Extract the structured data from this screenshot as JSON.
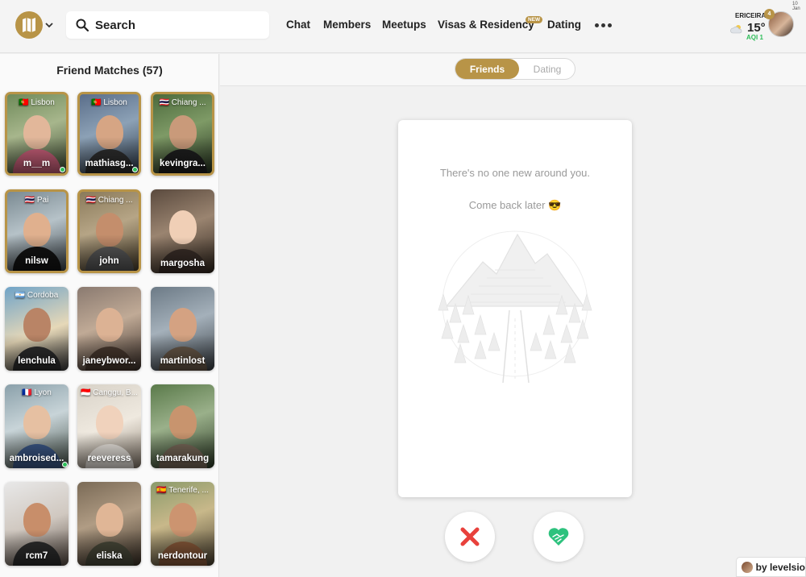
{
  "header": {
    "search_placeholder": "Search",
    "nav": [
      {
        "label": "Chat"
      },
      {
        "label": "Members"
      },
      {
        "label": "Meetups"
      },
      {
        "label": "Visas & Residency"
      },
      {
        "label": "Dating"
      }
    ],
    "new_badge": "NEW",
    "weather": {
      "city": "ERICEIRA",
      "temp": "15°",
      "aqi": "AQI 1"
    },
    "notification_count": "4",
    "date_corner": "10 Jan"
  },
  "sidebar": {
    "title": "Friend Matches (57)",
    "matches": [
      {
        "name": "m__m",
        "location": "🇵🇹 Lisbon",
        "highlight": true,
        "online": true
      },
      {
        "name": "mathiasg...",
        "location": "🇵🇹 Lisbon",
        "highlight": true,
        "online": true
      },
      {
        "name": "kevingra...",
        "location": "🇹🇭 Chiang ...",
        "highlight": true,
        "online": false
      },
      {
        "name": "nilsw",
        "location": "🇹🇭 Pai",
        "highlight": true,
        "online": false
      },
      {
        "name": "john",
        "location": "🇹🇭 Chiang ...",
        "highlight": true,
        "online": false
      },
      {
        "name": "margosha",
        "location": "",
        "highlight": false,
        "online": false
      },
      {
        "name": "lenchula",
        "location": "🇦🇷 Cordoba",
        "highlight": false,
        "online": false
      },
      {
        "name": "janeybwor...",
        "location": "",
        "highlight": false,
        "online": false
      },
      {
        "name": "martinlost",
        "location": "",
        "highlight": false,
        "online": false
      },
      {
        "name": "ambroised...",
        "location": "🇫🇷 Lyon",
        "highlight": false,
        "online": true
      },
      {
        "name": "reeveress",
        "location": "🇮🇩 Canggu, B...",
        "highlight": false,
        "online": false
      },
      {
        "name": "tamarakung",
        "location": "",
        "highlight": false,
        "online": false
      },
      {
        "name": "rcm7",
        "location": "",
        "highlight": false,
        "online": false
      },
      {
        "name": "eliska",
        "location": "",
        "highlight": false,
        "online": false
      },
      {
        "name": "nerdontour",
        "location": "🇪🇸 Tenerife, ...",
        "highlight": false,
        "online": false
      }
    ]
  },
  "main": {
    "tabs": {
      "friends": "Friends",
      "dating": "Dating",
      "active": "Friends"
    },
    "empty_line1": "There's no one new around you.",
    "empty_line2": "Come back later 😎",
    "actions": {
      "reject_icon": "x-icon",
      "accept_icon": "handshake-heart-icon"
    }
  },
  "byline": "by levelsio",
  "colors": {
    "accent": "#b89447",
    "online": "#2ebd59",
    "reject": "#e8413c",
    "accept": "#2ec27e"
  }
}
